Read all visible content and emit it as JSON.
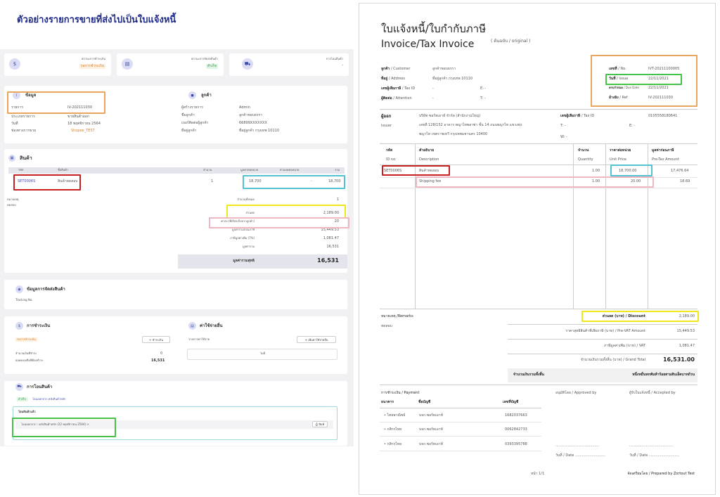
{
  "heading": "ตัวอย่างรายการขายที่ส่งไปเป็นใบแจ้งหนี้",
  "left": {
    "status": {
      "pay_label": "สถานะการชำระเงิน",
      "pay_value": "รอการชำระเงิน",
      "ship_label": "สถานะการจัดส่งสินค้า",
      "ship_value": "สำเร็จ",
      "transfer_label": "การโอนสินค้า",
      "transfer_value": "-"
    },
    "info": {
      "title": "ข้อมูล",
      "rows": [
        {
          "k": "รายการ",
          "v": "IV-202111030"
        },
        {
          "k": "ประเภทรายการ",
          "v": "ขายสินค้าออก"
        },
        {
          "k": "วันที่",
          "v": "18 พฤศจิกายน 2564"
        },
        {
          "k": "ช่องทางการขาย",
          "v": "Shopee_TEST"
        }
      ]
    },
    "customer": {
      "title": "ลูกค้า",
      "rows": [
        {
          "k": "ผู้สร้างรายการ",
          "v": "Admin"
        },
        {
          "k": "ชื่อลูกค้า",
          "v": "ลูกค้าชอบธรรา"
        },
        {
          "k": "เบอร์ติดต่อผู้ลูกค้า",
          "v": "66899XXXXXXX"
        },
        {
          "k": "ที่อยู่ลูกค้า",
          "v": "ที่อยู่ลูกค้า กรุงเทพ 10110"
        }
      ]
    },
    "products": {
      "title": "สินค้า",
      "headers": {
        "code": "รหัส",
        "name": "ชื่อสินค้า",
        "qty": "จำนวน",
        "price": "มูลค่าต่อหน่วย",
        "disc": "ส่วนลดต่อหน่วย",
        "total": "รวม"
      },
      "row": {
        "code": "SET0006S",
        "name": "สินค้าทดสอบ",
        "qty": "1",
        "price": "18,700",
        "disc": "-",
        "total": "18,700"
      },
      "remark_label": "หมายเหตุ",
      "remark_value": "ทดสอบ"
    },
    "summary": [
      {
        "k": "จำนวนทั้งหมด",
        "v": "1"
      },
      {
        "k": "ส่วนลด",
        "v": "2,189.00"
      },
      {
        "k": "ค่าส่ง (ที่เรียกเก็บจากลูกค้า)",
        "v": "20"
      },
      {
        "k": "มูลค่ารวมก่อนภาษี",
        "v": "15,449.53"
      },
      {
        "k": "ภาษีมูลค่าเพิ่ม (7%)",
        "v": "1,081.47"
      },
      {
        "k": "มูลค่ารวม",
        "v": "16,531"
      }
    ],
    "net": {
      "k": "มูลค่ารวมสุทธิ",
      "v": "16,531"
    },
    "shipping": {
      "title": "ข้อมูลการจัดส่งสินค้า",
      "tracking": "Tracking No."
    },
    "payment": {
      "title": "การชำระเงิน",
      "badge": "รอการชำระเงิน",
      "btn": "+ ชำระเงิน",
      "rows": [
        {
          "k": "จำนวนเงินที่ชำระ",
          "v": "0"
        },
        {
          "k": "ยอดคงเหลือที่ต้องชำระ",
          "v": "16,531"
        }
      ]
    },
    "expense": {
      "title": "ค่าใช้จ่ายอื่น",
      "label": "รายการค่าใช้จ่าย",
      "btn": "+ เพิ่มค่าใช้จ่ายอื่น",
      "empty": "ไม่มี"
    },
    "transfer": {
      "title": "การโอนสินค้า",
      "tab_done": "สำเร็จ",
      "tab_desc": "โอนออกจาก คลังสินค้าหลัก",
      "box_title": "โอนสินค้าแล้ว",
      "box_row": "โอนออกจาก : คลังสินค้าหลัก (22 พฤศจิกายน 2564) >",
      "print_btn": "พิมพ์"
    }
  },
  "right": {
    "title_th": "ใบแจ้งหนี้/ใบกำกับภาษี",
    "title_en": "Invoice/Tax Invoice",
    "original": "( ต้นฉบับ / original )",
    "customer_rows": [
      {
        "th": "ลูกค้า",
        "en": "/ Customer",
        "v": "ลูกค้าชอบธรรา"
      },
      {
        "th": "ที่อยู่",
        "en": "/ Address",
        "v": "ที่อยู่ลูกค้า กรุงเทพ 10110"
      },
      {
        "th": "เลขผู้เสียภาษี",
        "en": "/ Tax ID",
        "v": "-",
        "extra": "E: -"
      },
      {
        "th": "ผู้ติดต่อ",
        "en": "/ Attention",
        "v": "-",
        "extra": "T: -"
      }
    ],
    "doc_rows": [
      {
        "th": "เลขที่",
        "en": "/ No.",
        "v": "IVT-20211100005"
      },
      {
        "th": "วันที่",
        "en": "/ Issue",
        "v": "22/11/2021"
      },
      {
        "th": "ครบกำหนด",
        "en": "/ Due Date",
        "v": "22/11/2021"
      },
      {
        "th": "อ้างอิง",
        "en": "/ Ref",
        "v": "IV-202111030"
      }
    ],
    "issuer": {
      "th": "ผู้ออก",
      "en": "Issuer",
      "name": "บริษัท ซอร์ทเอาท์ จำกัด (สำนักงานใหญ่)",
      "addr1": "เลขที่ 128/152 อาคาร พญาไทพลาซ่า ชั้น 14 ถนนพญาไท แขวงทุ่ง",
      "addr2": "พญาไท เขตราชเทวี กรุงเทพมหานคร 10400",
      "tax_th": "เลขผู้เสียภาษี",
      "tax_en": "/ Tax ID",
      "tax_v": "0105558180641",
      "t": "T: -",
      "e": "E: -",
      "w": "W: -"
    },
    "table": {
      "headers": [
        {
          "th": "รหัส",
          "en": "ID no."
        },
        {
          "th": "คำอธิบาย",
          "en": "Description"
        },
        {
          "th": "จำนวน",
          "en": "Quantity"
        },
        {
          "th": "ราคาต่อหน่วย",
          "en": "Unit Price"
        },
        {
          "th": "มูลค่าก่อนภาษี",
          "en": "Pre-Tax Amount"
        }
      ],
      "rows": [
        {
          "code": "SET0006S",
          "desc": "สินค้าทดสอบ",
          "qty": "1.00",
          "price": "18,700.00",
          "amount": "17,476.64"
        },
        {
          "code": "",
          "desc": "Shipping fee",
          "qty": "1.00",
          "price": "20.00",
          "amount": "18.69"
        }
      ]
    },
    "remarks": {
      "label": "หมายเหตุ /Remarks",
      "value": "ทดสอบ"
    },
    "totals": [
      {
        "k": "ส่วนลด (บาท) / Discount",
        "v": "2,189.00"
      },
      {
        "k": "ราคาสุทธิสินค้าที่เสียภาษี (บาท) / Pre-VAT Amount",
        "v": "15,449.53"
      },
      {
        "k": "ภาษีมูลค่าเพิ่ม (บาท) / VAT",
        "v": "1,081.47"
      },
      {
        "k": "จำนวนเงินรวมทั้งสิ้น (บาท) / Grand Total",
        "v": "16,531.00"
      }
    ],
    "amount_words": {
      "k": "จำนวนเงินรวมทั้งสิ้น",
      "v": "หนึ่งหมื่นหกพันห้าร้อยสามสิบเอ็ดบาทถ้วน"
    },
    "payment": {
      "title": "การชำระเงิน / Payment",
      "bank_h": "ธนาคาร",
      "acc_name_h": "ชื่อบัญชี",
      "acc_no_h": "เลขที่บัญชี",
      "rows": [
        {
          "bank": "• ไทยพาณิชย์",
          "name": "บจก.ซอร์ทเอาท์",
          "no": "1682037663"
        },
        {
          "bank": "• กสิกรไทย",
          "name": "บจก.ซอร์ทเอาท์",
          "no": "0062842733"
        },
        {
          "bank": "• กสิกรไทย",
          "name": "บจก.ซอร์ทเอาท์",
          "no": "0393395788"
        }
      ]
    },
    "approved": "อนุมัติโดย / Approved by",
    "accepted": "ผู้รับใบแจ้งหนี้ / Accepted by",
    "date_line": "วันที่ / Date ...........................",
    "page": "หน้า 1/1",
    "prepared": "จัดเตรียมโดย / Prepared by Zortout Test"
  }
}
